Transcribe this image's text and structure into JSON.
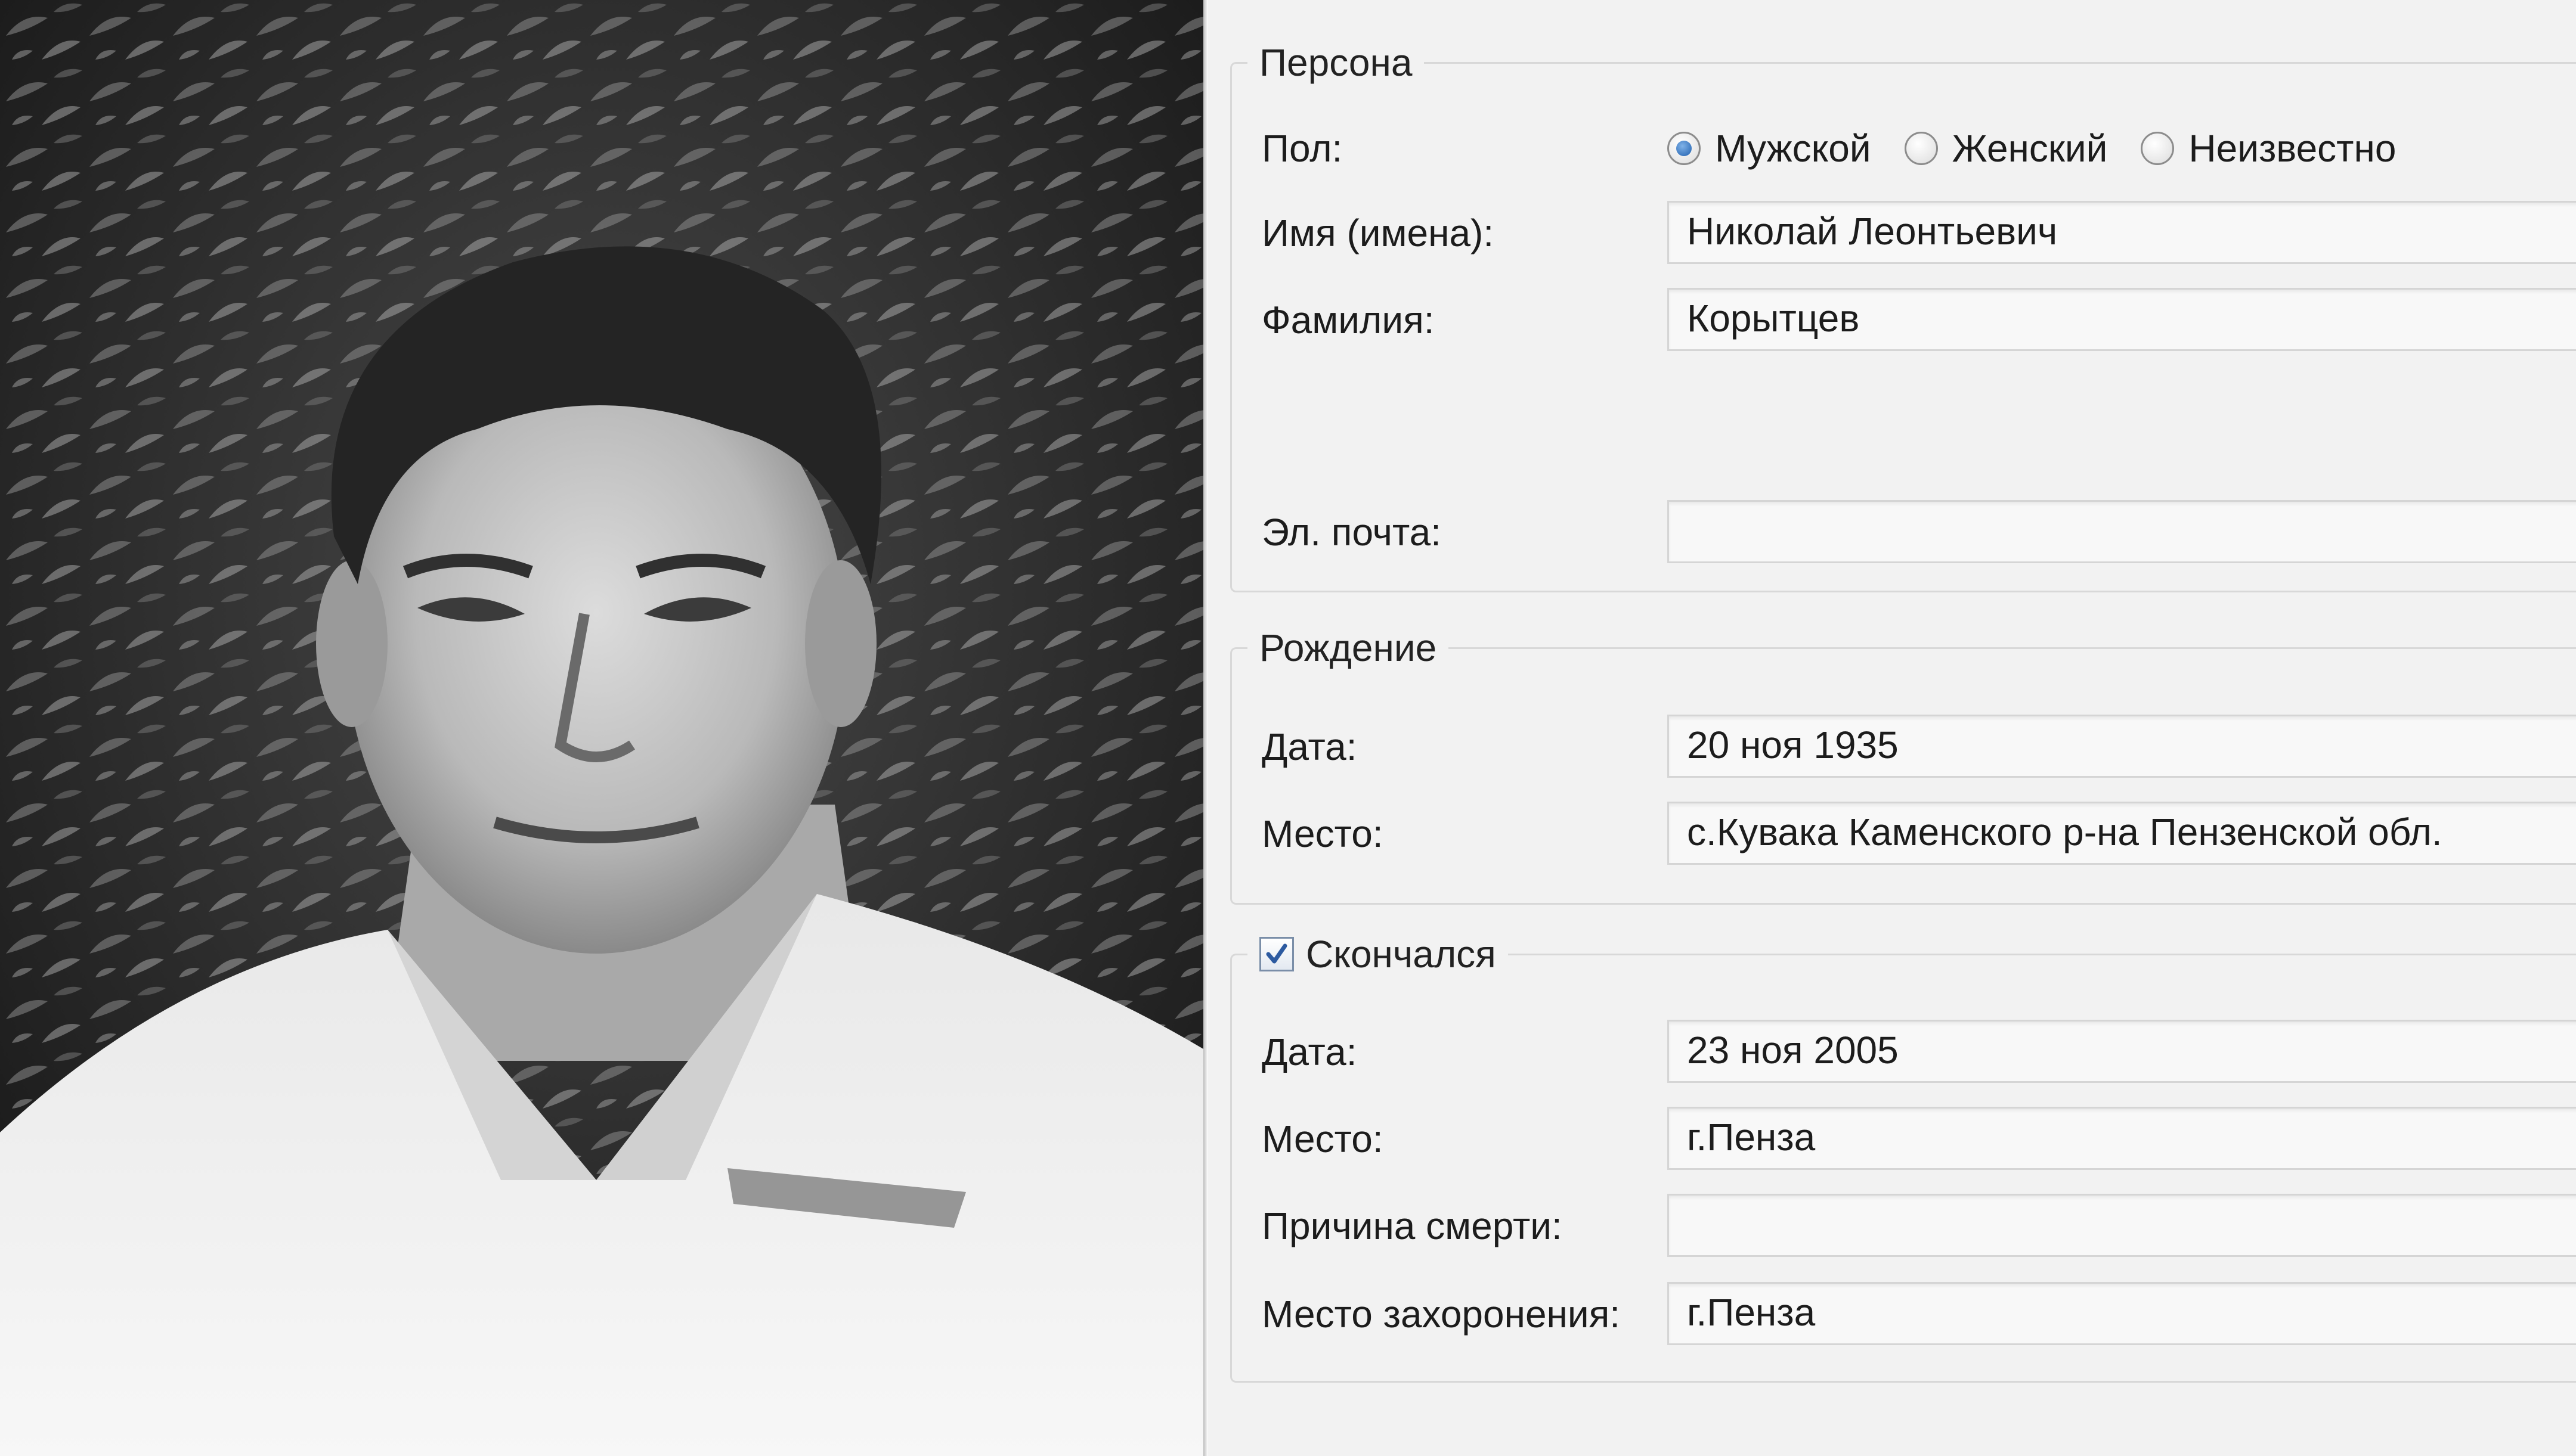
{
  "person": {
    "legend": "Персона",
    "gender_label": "Пол:",
    "gender_options": [
      "Мужской",
      "Женский",
      "Неизвестно"
    ],
    "gender_selected": "Мужской",
    "given_names_label": "Имя (имена):",
    "given_names_value": "Николай Леонтьевич",
    "surname_label": "Фамилия:",
    "surname_value": "Корытцев",
    "email_label": "Эл. почта:",
    "email_value": ""
  },
  "birth": {
    "legend": "Рождение",
    "date_label": "Дата:",
    "date_value": "20 ноя 1935",
    "place_label": "Место:",
    "place_value": "с.Кувака Каменского р-на Пензенской обл."
  },
  "death": {
    "legend": "Скончался",
    "deceased_checked": true,
    "date_label": "Дата:",
    "date_value": "23 ноя 2005",
    "place_label": "Место:",
    "place_value": "г.Пенза",
    "cause_label": "Причина смерти:",
    "cause_value": "",
    "burial_label": "Место захоронения:",
    "burial_value": "г.Пенза"
  },
  "colors": {
    "panel_bg": "#f2f2f2",
    "field_bg": "#f8f8f8",
    "radio_accent": "#1f5fae"
  }
}
